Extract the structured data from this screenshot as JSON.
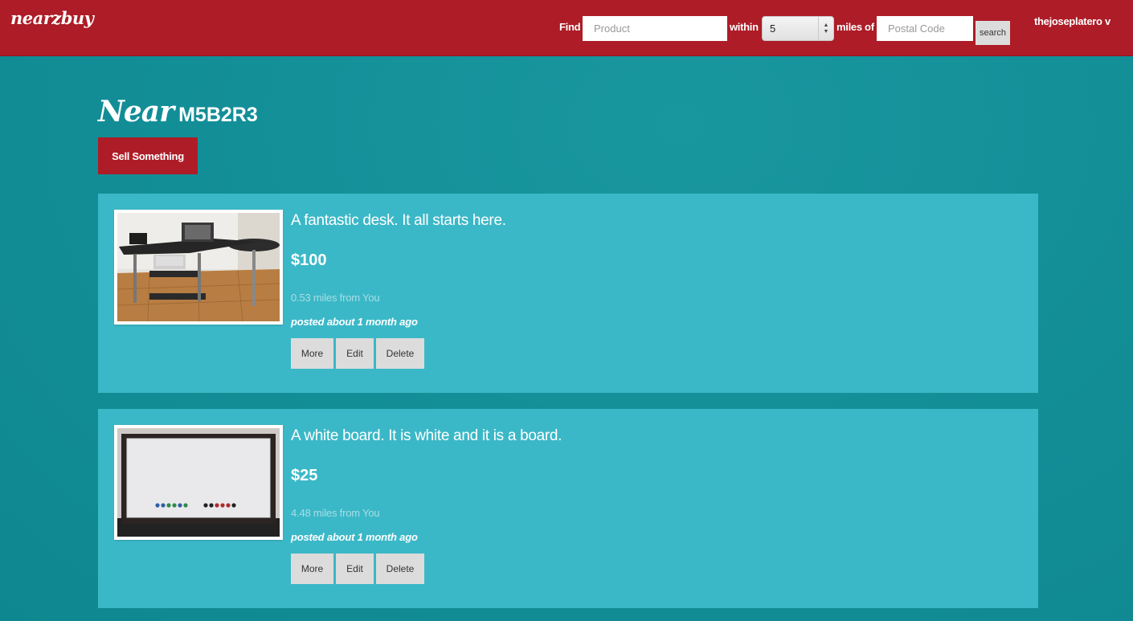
{
  "header": {
    "brand": "nearzbuy",
    "find_label": "Find",
    "product_placeholder": "Product",
    "within_label": "within",
    "radius_value": "5",
    "miles_label": "miles of",
    "postal_placeholder": "Postal Code",
    "search_label": "search",
    "user_menu": "thejoseplatero v"
  },
  "main": {
    "near_word": "Near",
    "postal_code": "M5B2R3",
    "sell_button": "Sell Something"
  },
  "listings": [
    {
      "title": "A fantastic desk. It all starts here.",
      "price": "$100",
      "distance": "0.53 miles from You",
      "posted": "posted about 1 month ago",
      "actions": [
        "More",
        "Edit",
        "Delete"
      ]
    },
    {
      "title": "A white board. It is white and it is a board.",
      "price": "$25",
      "distance": "4.48 miles from You",
      "posted": "posted about 1 month ago",
      "actions": [
        "More",
        "Edit",
        "Delete"
      ]
    }
  ],
  "colors": {
    "brand_red": "#ad1c27",
    "page_teal": "#138f98",
    "card_teal": "#3bb8c7",
    "button_gray": "#dcdcdc"
  }
}
